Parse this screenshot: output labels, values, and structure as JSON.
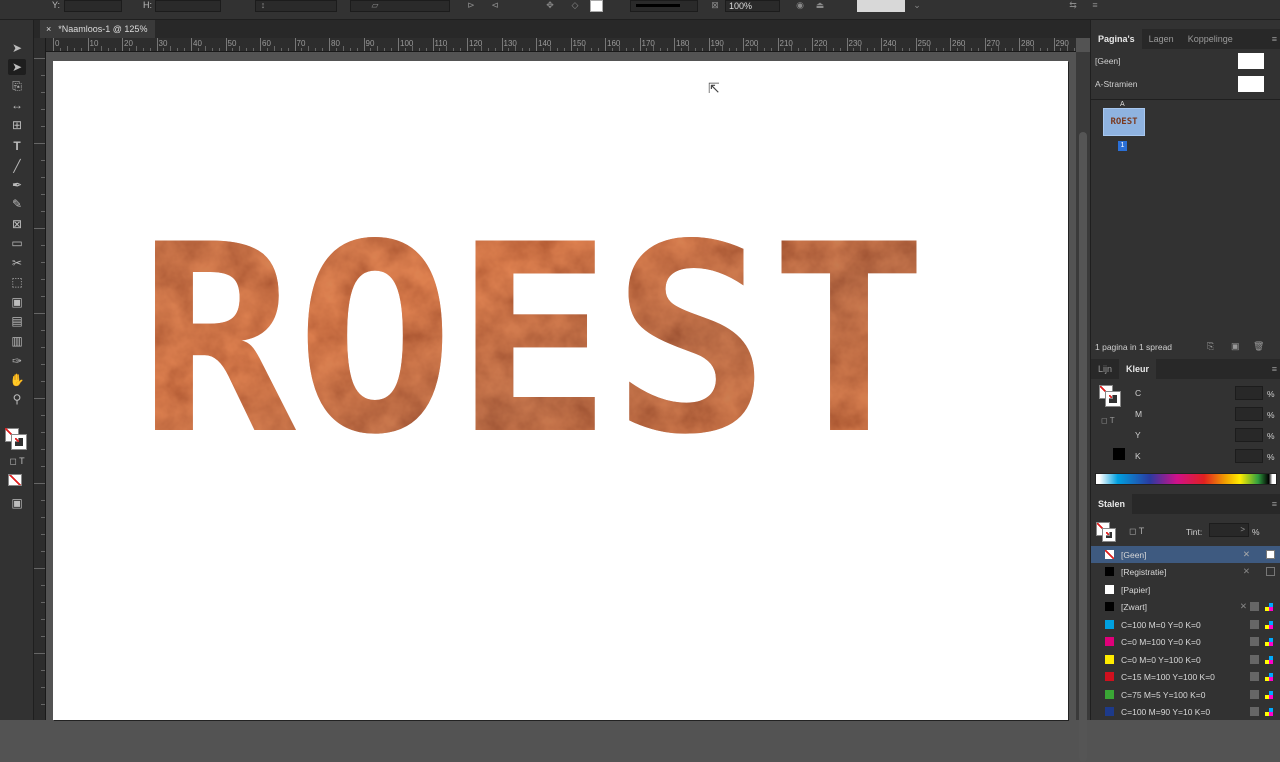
{
  "control_bar": {
    "y_label": "Y:",
    "h_label": "H:",
    "zoom_value": "100%"
  },
  "document_tab": {
    "close": "×",
    "title": "*Naamloos-1 @ 125%"
  },
  "ruler": {
    "h_labels": [
      "0",
      "10",
      "20",
      "30",
      "40",
      "50",
      "60",
      "70",
      "80",
      "90",
      "100",
      "110",
      "120",
      "130",
      "140",
      "150",
      "160",
      "170",
      "180",
      "190",
      "200",
      "210",
      "220",
      "230",
      "240",
      "250",
      "260",
      "270",
      "280",
      "290"
    ]
  },
  "canvas": {
    "headline": "ROEST"
  },
  "pages_panel": {
    "tabs": [
      "Pagina's",
      "Lagen",
      "Koppelinge"
    ],
    "master_none": "[Geen]",
    "master_a": "A-Stramien",
    "thumb_text": "ROEST",
    "thumb_master_marker": "A",
    "page_number": "1",
    "footer": "1 pagina in 1 spread"
  },
  "color_panel": {
    "tabs": [
      "Lijn",
      "Kleur"
    ],
    "channels": [
      "C",
      "M",
      "Y",
      "K"
    ],
    "percent": "%"
  },
  "swatches_panel": {
    "title": "Stalen",
    "tint_label": "Tint:",
    "tint_value": ">",
    "percent": "%",
    "items": [
      {
        "name": "[Geen]",
        "color": "none"
      },
      {
        "name": "[Registratie]",
        "color": "#000000"
      },
      {
        "name": "[Papier]",
        "color": "#ffffff"
      },
      {
        "name": "[Zwart]",
        "color": "#000000"
      },
      {
        "name": "C=100 M=0 Y=0 K=0",
        "color": "#00a0e0"
      },
      {
        "name": "C=0 M=100 Y=0 K=0",
        "color": "#e0007a"
      },
      {
        "name": "C=0 M=0 Y=100 K=0",
        "color": "#ffec00"
      },
      {
        "name": "C=15 M=100 Y=100 K=0",
        "color": "#d0101e"
      },
      {
        "name": "C=75 M=5 Y=100 K=0",
        "color": "#3aa635"
      },
      {
        "name": "C=100 M=90 Y=10 K=0",
        "color": "#1d3a8a"
      }
    ]
  },
  "colors": {
    "selected_swatch_row": "#3e5a80",
    "page_badge": "#2a6fd6",
    "rust_dark": "#7a2a14",
    "rust_mid": "#a8401f",
    "rust_bright": "#d65a24"
  }
}
